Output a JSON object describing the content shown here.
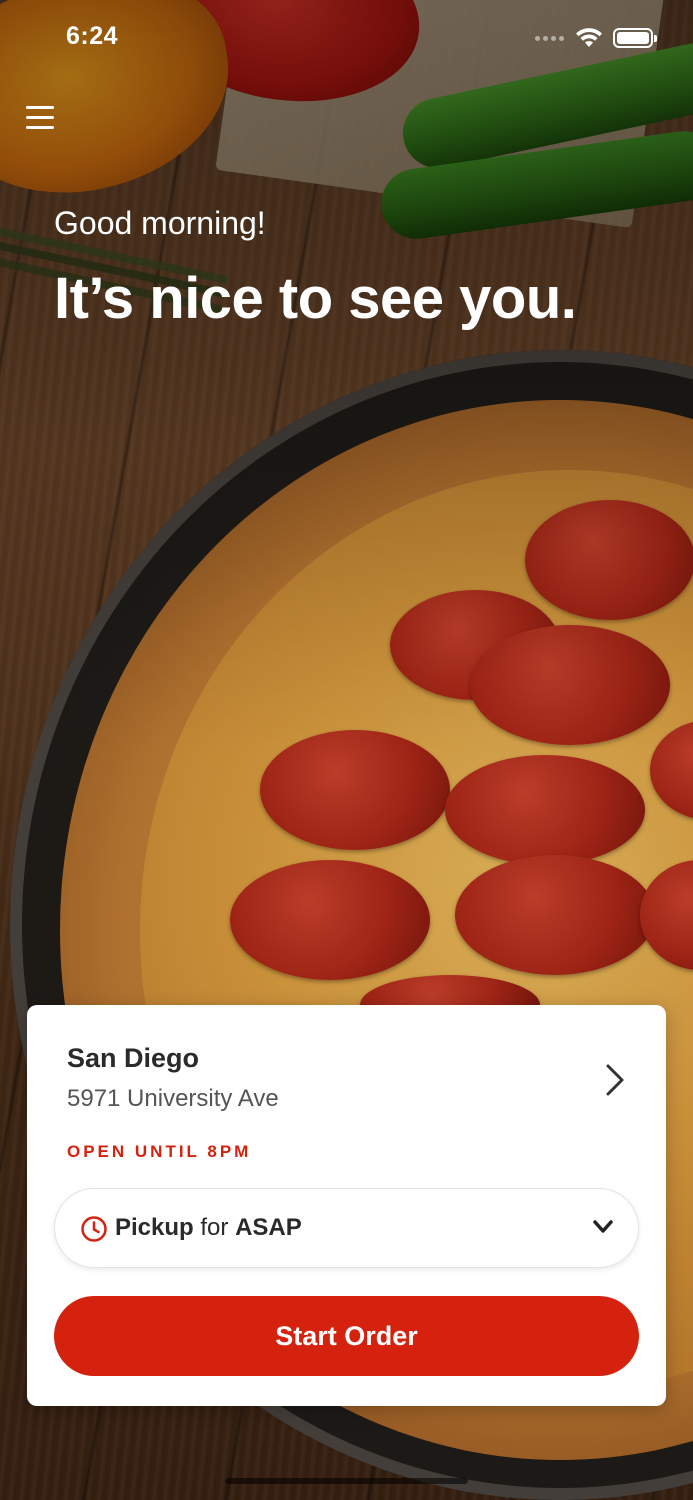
{
  "status_bar": {
    "time": "6:24"
  },
  "header": {
    "menu_icon": "hamburger-menu-icon",
    "greeting": "Good morning!",
    "headline": "It’s nice to see you."
  },
  "store_card": {
    "store_name": "San Diego",
    "store_address": "5971 University Ave",
    "hours": "OPEN UNTIL 8PM",
    "pickup": {
      "mode": "Pickup",
      "connector": "for",
      "time": "ASAP"
    },
    "start_order_label": "Start Order"
  },
  "colors": {
    "accent": "#d4220f",
    "card_background": "#ffffff",
    "text_primary": "#2a2a2a",
    "text_secondary": "#555555"
  }
}
